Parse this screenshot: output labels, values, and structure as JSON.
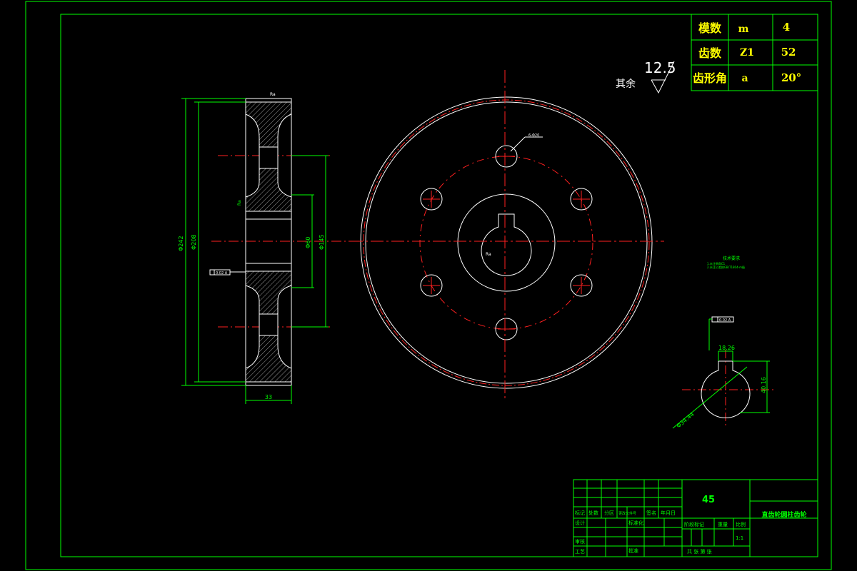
{
  "params_table": {
    "rows": [
      {
        "name": "模数",
        "symbol": "m",
        "value": "4"
      },
      {
        "name": "齿数",
        "symbol": "Z1",
        "value": "52"
      },
      {
        "name": "齿形角",
        "symbol": "a",
        "value": "20°"
      }
    ]
  },
  "roughness": {
    "label": "其余",
    "value": "12.5"
  },
  "side_view": {
    "dim_width": "33",
    "dim_d242": "Φ242",
    "dim_d208": "Φ208",
    "dim_d60": "Φ60",
    "dim_d145": "Φ145",
    "small_top_label": "Ra",
    "side_label": "Ra",
    "tolerance_box": "0.02 A"
  },
  "front_view": {
    "hole_note": "6-Φ20",
    "center_mark": "Ra"
  },
  "tech_requirements": {
    "title": "技术要求",
    "items": [
      "1.未注倒角C1",
      "2.未注公差按GB/T1804-m级"
    ]
  },
  "keyway_detail": {
    "tolerance_box": "0.02 A",
    "dim_top": "18.26",
    "dim_height": "40.16",
    "dim_diameter": "Φ34.44"
  },
  "title_block": {
    "material": "45",
    "part_name": "直齿轮圆柱齿轮",
    "labels": {
      "mark": "标记",
      "count": "处数",
      "zone": "分区",
      "change_doc": "更改文件号",
      "sign": "签名",
      "date": "年月日",
      "design": "设计",
      "standard": "标准化",
      "stage_mark": "阶段标记",
      "weight": "重量",
      "scale": "比例",
      "check": "审核",
      "craft": "工艺",
      "approve": "批准",
      "sheets": "共 张 第 张",
      "scale_value": "1:1"
    }
  }
}
